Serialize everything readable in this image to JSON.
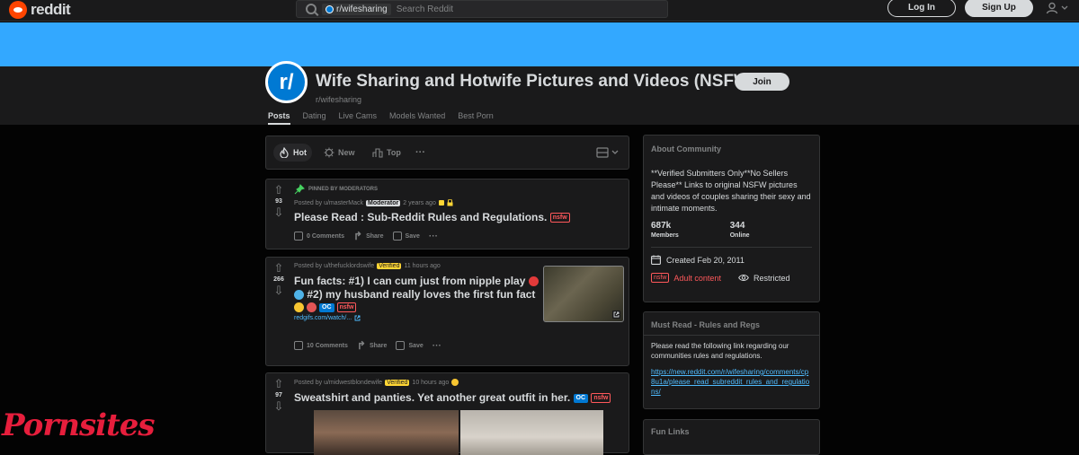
{
  "header": {
    "logo_text": "reddit",
    "search_chip": "r/wifesharing",
    "search_placeholder": "Search Reddit",
    "login_label": "Log In",
    "signup_label": "Sign Up"
  },
  "subreddit": {
    "avatar_text": "r/",
    "title": "Wife Sharing and Hotwife Pictures and Videos (NSFW)",
    "name": "r/wifesharing",
    "join_label": "Join",
    "tabs": [
      {
        "label": "Posts",
        "active": true
      },
      {
        "label": "Dating",
        "active": false
      },
      {
        "label": "Live Cams",
        "active": false
      },
      {
        "label": "Models Wanted",
        "active": false
      },
      {
        "label": "Best Porn",
        "active": false
      }
    ]
  },
  "sort": {
    "hot": "Hot",
    "new": "New",
    "top": "Top",
    "more": "···"
  },
  "posts": [
    {
      "pinned_label": "PINNED BY MODERATORS",
      "score": "93",
      "posted_by": "Posted by u/masterMack",
      "flair": "Moderator",
      "time": "2 years ago",
      "title": "Please Read : Sub-Reddit Rules and Regulations.",
      "nsfw": "nsfw",
      "comments": "0 Comments",
      "share": "Share",
      "save": "Save",
      "more": "···"
    },
    {
      "score": "266",
      "posted_by": "Posted by u/thefucklordswife",
      "flair": "Verified",
      "time": "11 hours ago",
      "title_line1": "Fun facts: #1) I can cum just from nipple play",
      "title_line2": "#2) my husband really loves the first fun fact",
      "oc": "OC",
      "nsfw": "nsfw",
      "link": "redgifs.com/watch/...",
      "comments": "10 Comments",
      "share": "Share",
      "save": "Save",
      "more": "···"
    },
    {
      "score": "97",
      "posted_by": "Posted by u/midwestblondewife",
      "flair": "Verified",
      "time": "10 hours ago",
      "title": "Sweatshirt and panties. Yet another great outfit in her.",
      "oc": "OC",
      "nsfw": "nsfw"
    }
  ],
  "sidebar": {
    "about_header": "About Community",
    "about_text": "**Verified Submitters Only**No Sellers Please** Links to original NSFW pictures and videos of couples sharing their sexy and intimate moments.",
    "members_count": "687k",
    "members_label": "Members",
    "online_count": "344",
    "online_label": "Online",
    "created": "Created Feb 20, 2011",
    "nsfw": "nsfw",
    "adult_content": "Adult content",
    "restricted": "Restricted",
    "must_read_header": "Must Read - Rules and Regs",
    "must_read_text": "Please read the following link regarding our communities rules and regulations.",
    "must_read_link": "https://new.reddit.com/r/wifesharing/comments/cp8u1a/please_read_subreddit_rules_and_regulations/",
    "fun_links_header": "Fun Links"
  },
  "watermark": "Pornsites",
  "colors": {
    "banner": "#33a8ff",
    "accent": "#0079d3",
    "nsfw": "#ff585b",
    "verified": "#ffd635",
    "watermark": "#e61e3c"
  }
}
